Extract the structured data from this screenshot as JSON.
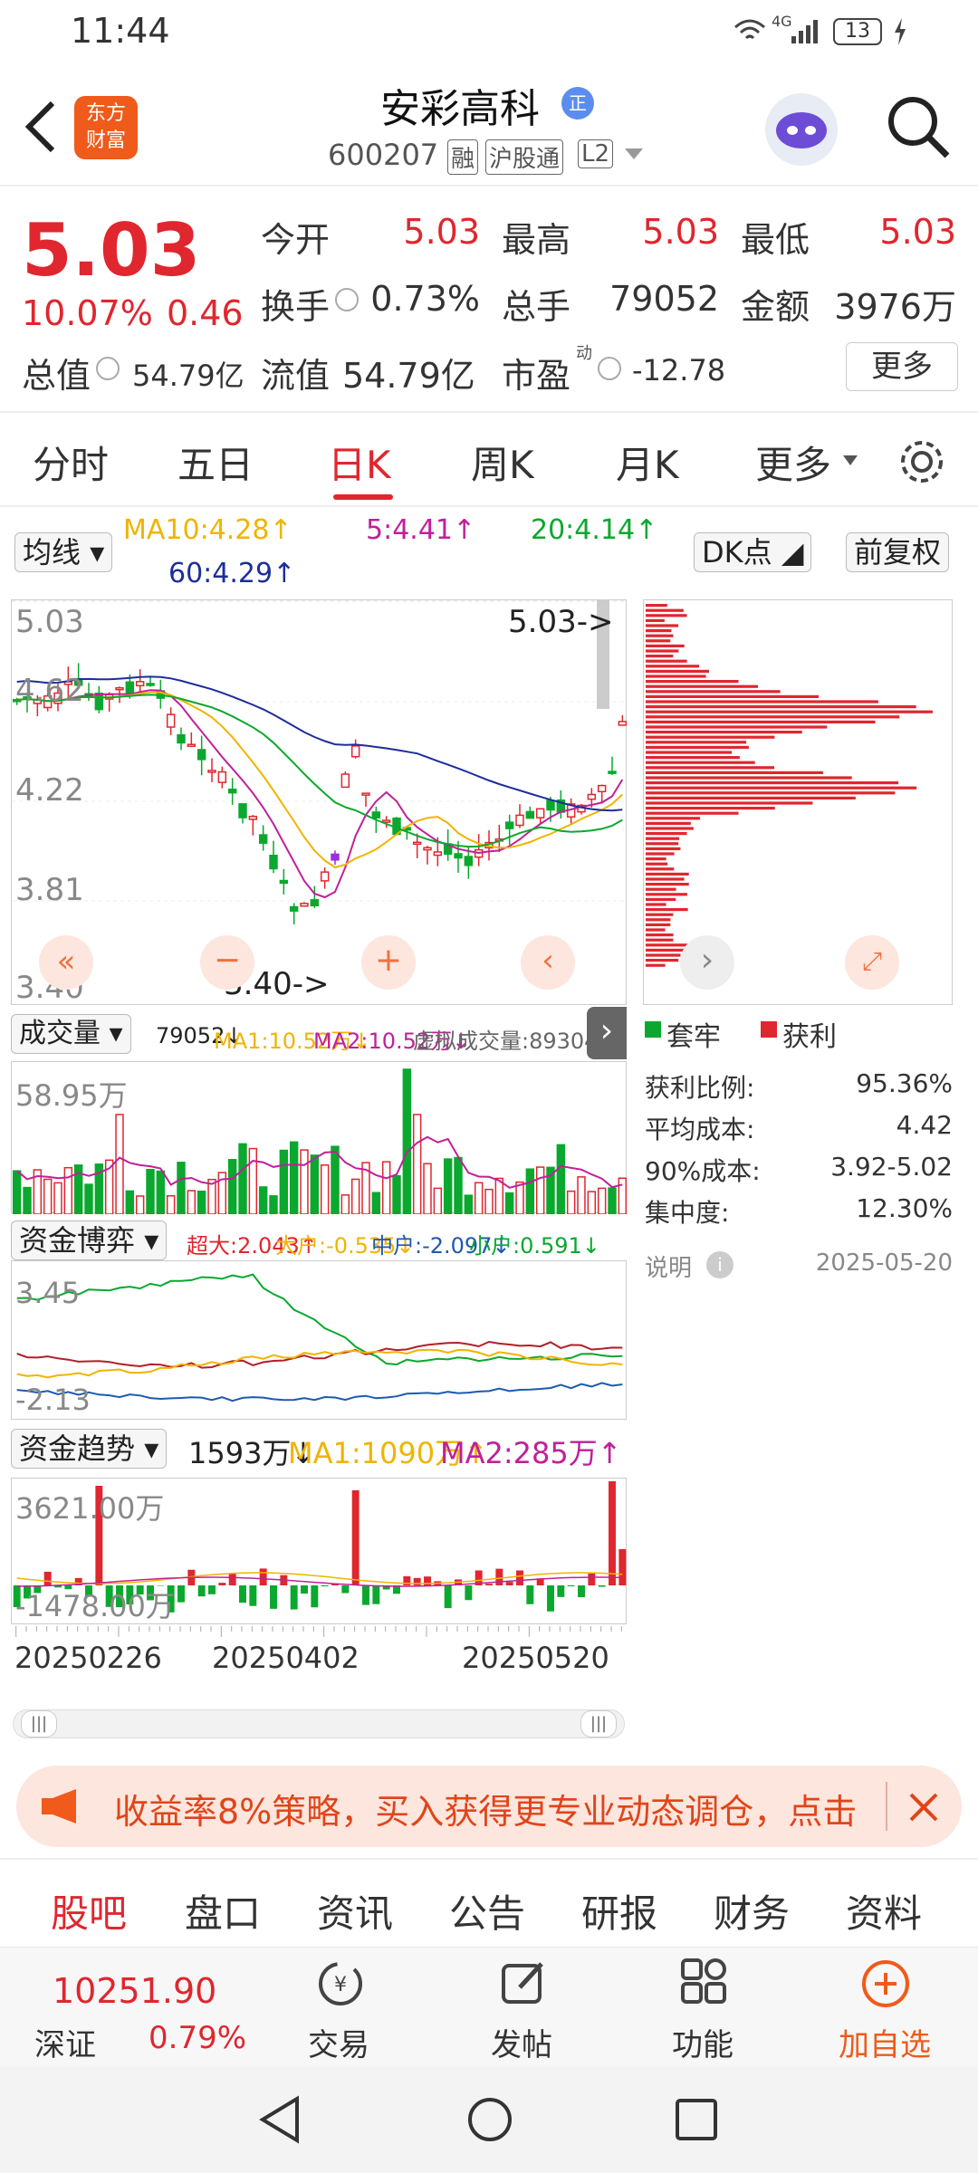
{
  "status": {
    "time": "11:44",
    "battery": "13",
    "network": "4G"
  },
  "header": {
    "title": "安彩高科",
    "title_badge": "正",
    "subtitle_code": "600207",
    "tags": [
      "融",
      "沪股通",
      "L2"
    ],
    "logo_line1": "东方",
    "logo_line2": "财富"
  },
  "quote": {
    "price": "5.03",
    "change_pct": "10.07%",
    "change_amt": "0.46",
    "open_label": "今开",
    "open": "5.03",
    "high_label": "最高",
    "high": "5.03",
    "low_label": "最低",
    "low": "5.03",
    "turnover_label": "换手",
    "turnover": "0.73%",
    "volume_label": "总手",
    "volume": "79052",
    "amount_label": "金额",
    "amount": "3976万",
    "mktcap_label": "总值",
    "mktcap": "54.79亿",
    "float_label": "流值",
    "float": "54.79亿",
    "pe_label": "市盈",
    "pe_sup": "动",
    "pe": "-12.78",
    "more": "更多"
  },
  "tabs": [
    "分时",
    "五日",
    "日K",
    "周K",
    "月K",
    "更多"
  ],
  "indicator": {
    "select": "均线",
    "ma10": "MA10:4.28↑",
    "ma5": "5:4.41↑",
    "ma20": "20:4.14↑",
    "ma60": "60:4.29↑",
    "dk": "DK点",
    "fq": "前复权"
  },
  "kline": {
    "ytop": "5.03",
    "y2": "4.62",
    "y3": "4.22",
    "y4": "3.81",
    "ybot": "3.40",
    "max_mark": "5.03->",
    "min_mark": "3.40->"
  },
  "volume_panel": {
    "select": "成交量",
    "text": "79052↓",
    "ma1": "MA1:10.52万↓",
    "ma2": "MA2:10.52万↓",
    "virt": "虚拟成交量:89304",
    "ymax": "58.95万"
  },
  "fund_panel": {
    "select": "资金博弈",
    "super": "超大:2.043↑",
    "big": "大户:-0.535↓",
    "mid": "中户:-2.097↓",
    "small": "小户:0.591↓",
    "ymax": "3.45",
    "ymin": "-2.13"
  },
  "trend_panel": {
    "select": "资金趋势",
    "val": "1593万↓",
    "ma1": "MA1:1090万↑",
    "ma2": "MA2:285万↑",
    "ymax": "3621.00万",
    "ymin": "-1478.00万"
  },
  "dates": [
    "20250226",
    "20250402",
    "20250520"
  ],
  "chip": {
    "legend_trap": "套牢",
    "legend_profit": "获利",
    "rows": [
      {
        "label": "获利比例:",
        "value": "95.36%"
      },
      {
        "label": "平均成本:",
        "value": "4.42"
      },
      {
        "label": "90%成本:",
        "value": "3.92-5.02"
      },
      {
        "label": "集中度:",
        "value": "12.30%"
      }
    ],
    "note": "说明",
    "date": "2025-05-20"
  },
  "banner": {
    "text": "收益率8%策略，买入获得更专业动态调仓，点击"
  },
  "bottom_tabs": [
    "股吧",
    "盘口",
    "资讯",
    "公告",
    "研报",
    "财务",
    "资料"
  ],
  "dock": {
    "index_value": "10251.90",
    "index_name": "深证",
    "index_pct": "0.79%",
    "trade": "交易",
    "post": "发帖",
    "func": "功能",
    "add": "加自选"
  },
  "colors": {
    "red": "#e0262e",
    "green": "#0aa82e",
    "purple": "#c0209a",
    "orange": "#f0b400",
    "blue": "#1d2e9a"
  }
}
